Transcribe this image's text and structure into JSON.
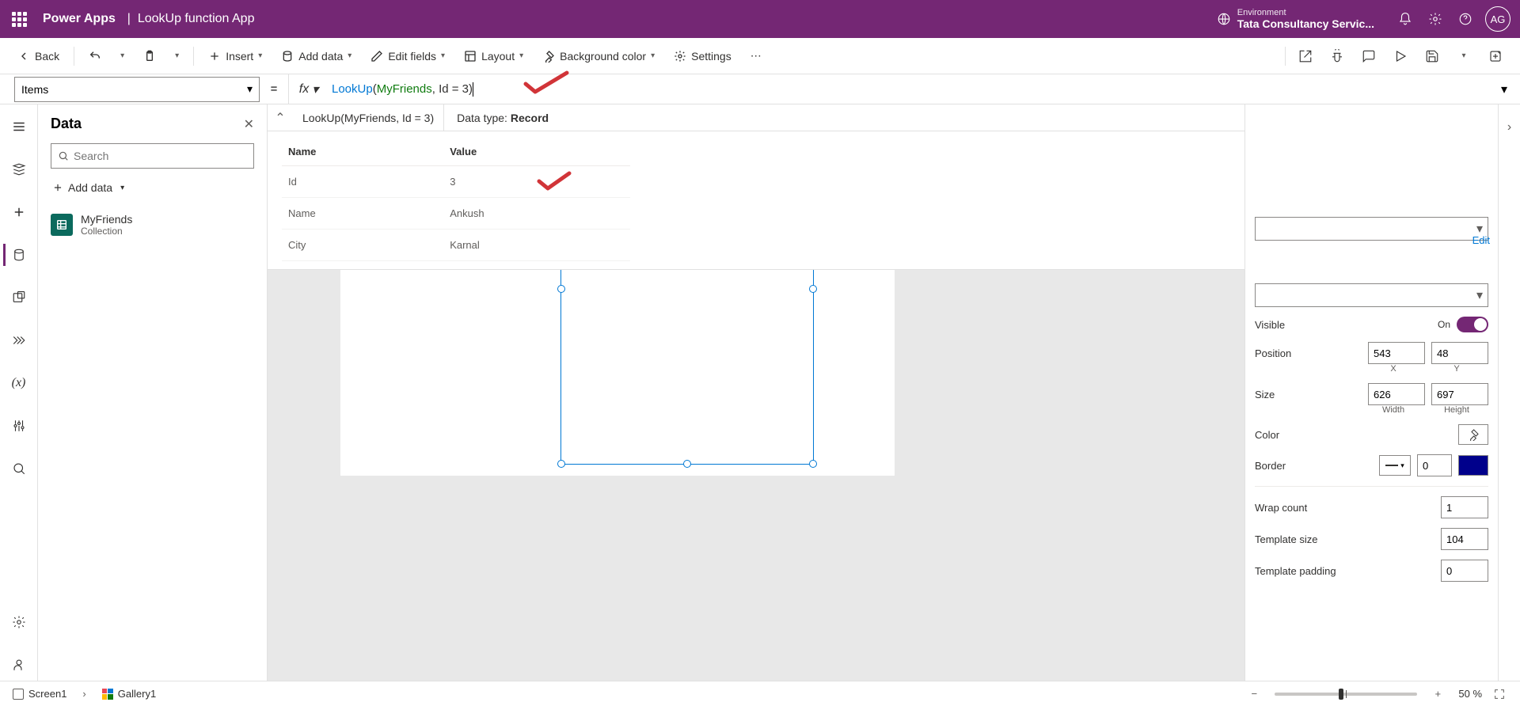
{
  "header": {
    "app_name": "Power Apps",
    "separator": "|",
    "file_name": "LookUp function App",
    "environment_label": "Environment",
    "environment_name": "Tata Consultancy Servic...",
    "avatar_initials": "AG"
  },
  "cmdbar": {
    "back": "Back",
    "insert": "Insert",
    "add_data": "Add data",
    "edit_fields": "Edit fields",
    "layout": "Layout",
    "background_color": "Background color",
    "settings": "Settings"
  },
  "formula": {
    "property": "Items",
    "eq": "=",
    "fx": "fx",
    "tokens": {
      "fn": "LookUp",
      "open": "(",
      "ds": "MyFriends",
      "comma": ", ",
      "expr": "Id = 3",
      "close": ")"
    }
  },
  "record_preview": {
    "formula_text": "LookUp(MyFriends, Id = 3)",
    "data_type_label": "Data type: ",
    "data_type_value": "Record",
    "columns": {
      "name": "Name",
      "value": "Value"
    },
    "rows": [
      {
        "name": "Id",
        "value": "3"
      },
      {
        "name": "Name",
        "value": "Ankush"
      },
      {
        "name": "City",
        "value": "Karnal"
      }
    ]
  },
  "data_panel": {
    "title": "Data",
    "search_placeholder": "Search",
    "add_data": "Add data",
    "items": [
      {
        "name": "MyFriends",
        "type": "Collection"
      }
    ]
  },
  "properties": {
    "edit": "Edit",
    "visible_label": "Visible",
    "visible_state": "On",
    "position_label": "Position",
    "position_x": "543",
    "position_y": "48",
    "x_label": "X",
    "y_label": "Y",
    "size_label": "Size",
    "size_w": "626",
    "size_h": "697",
    "w_label": "Width",
    "h_label": "Height",
    "color_label": "Color",
    "border_label": "Border",
    "border_width": "0",
    "border_color": "#00008b",
    "wrap_label": "Wrap count",
    "wrap_value": "1",
    "template_size_label": "Template size",
    "template_size_value": "104",
    "template_padding_label": "Template padding",
    "template_padding_value": "0"
  },
  "status": {
    "screen": "Screen1",
    "selected": "Gallery1",
    "zoom": "50",
    "zoom_unit": "%"
  }
}
